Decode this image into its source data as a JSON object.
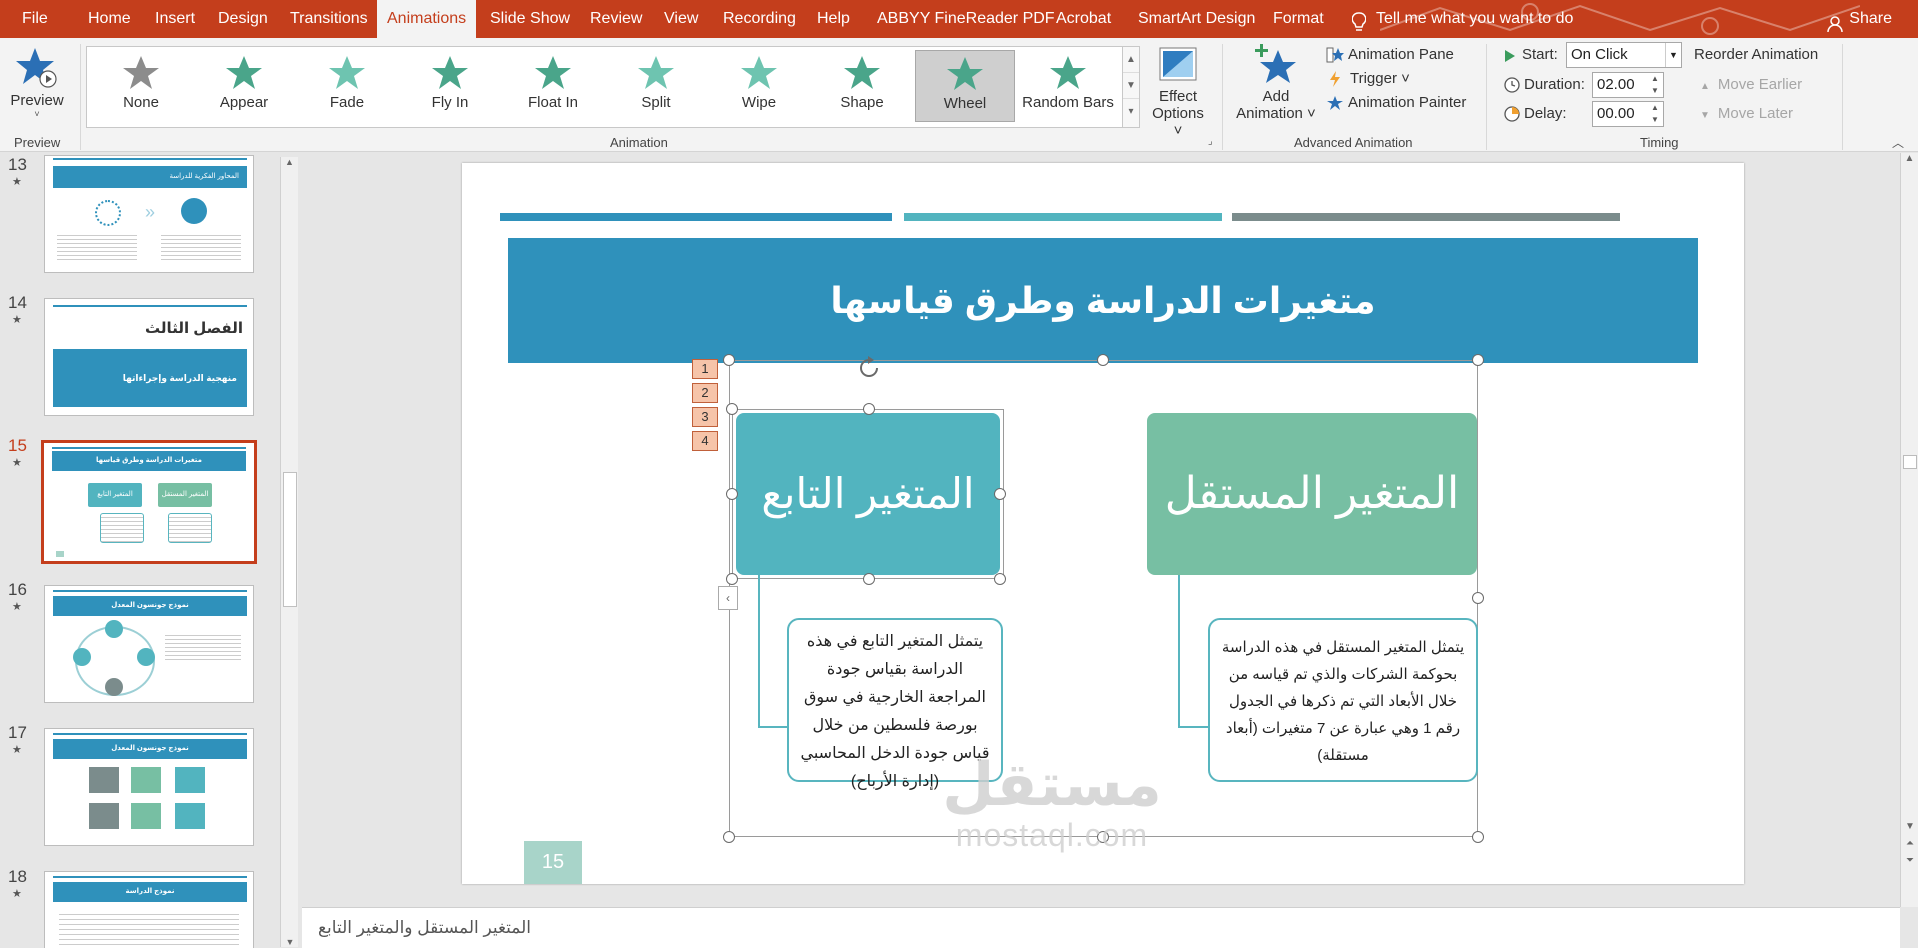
{
  "tabs": [
    {
      "label": "File"
    },
    {
      "label": "Home"
    },
    {
      "label": "Insert"
    },
    {
      "label": "Design"
    },
    {
      "label": "Transitions"
    },
    {
      "label": "Animations",
      "active": true
    },
    {
      "label": "Slide Show"
    },
    {
      "label": "Review"
    },
    {
      "label": "View"
    },
    {
      "label": "Recording"
    },
    {
      "label": "Help"
    },
    {
      "label": "ABBYY FineReader PDF"
    },
    {
      "label": "Acrobat"
    },
    {
      "label": "SmartArt Design"
    },
    {
      "label": "Format"
    }
  ],
  "tell_me": "Tell me what you want to do",
  "share": "Share",
  "ribbon": {
    "preview_label": "Preview",
    "preview_group": "Preview",
    "animations": [
      {
        "label": "None",
        "color": "#8c8c8c"
      },
      {
        "label": "Appear",
        "color": "#4aa58a"
      },
      {
        "label": "Fade",
        "color": "#6ec4b0"
      },
      {
        "label": "Fly In",
        "color": "#4aa58a"
      },
      {
        "label": "Float In",
        "color": "#4aa58a"
      },
      {
        "label": "Split",
        "color": "#6ec4b0"
      },
      {
        "label": "Wipe",
        "color": "#6ec4b0"
      },
      {
        "label": "Shape",
        "color": "#4aa58a"
      },
      {
        "label": "Wheel",
        "color": "#4aa58a",
        "selected": true
      },
      {
        "label": "Random Bars",
        "color": "#4aa58a"
      }
    ],
    "effect_options_1": "Effect",
    "effect_options_2": "Options ˅",
    "animation_group": "Animation",
    "add_animation_1": "Add",
    "add_animation_2": "Animation ˅",
    "animation_pane": "Animation Pane",
    "trigger": "Trigger ˅",
    "animation_painter": "Animation Painter",
    "advanced_group": "Advanced Animation",
    "start_label": "Start:",
    "start_value": "On Click",
    "duration_label": "Duration:",
    "duration_value": "02.00",
    "delay_label": "Delay:",
    "delay_value": "00.00",
    "timing_group": "Timing",
    "reorder": "Reorder Animation",
    "move_earlier": "Move Earlier",
    "move_later": "Move Later"
  },
  "thumbnails": [
    {
      "num": "13",
      "title": "المحاور الفكرية للدراسة"
    },
    {
      "num": "14",
      "title": "الفصل الثالث",
      "subtitle": "منهجية الدراسة وإجراءاتها"
    },
    {
      "num": "15",
      "title": "متغيرات الدراسة وطرق قياسها",
      "left": "المتغير التابع",
      "right": "المتغير المستقل",
      "active": true
    },
    {
      "num": "16",
      "title": "نموذج جونسون المعدل"
    },
    {
      "num": "17",
      "title": "نموذج جونسون المعدل"
    },
    {
      "num": "18",
      "title": "نموذج الدراسة"
    }
  ],
  "slide": {
    "title": "متغيرات الدراسة وطرق قياسها",
    "dependent_header": "المتغير التابع",
    "independent_header": "المتغير المستقل",
    "dependent_desc": "يتمثل المتغير التابع في هذه الدراسة بقياس جودة المراجعة الخارجية في سوق بورصة فلسطين من خلال قياس جودة الدخل المحاسبي (إدارة الأرباح)",
    "independent_desc": "يتمثل المتغير المستقل في هذه الدراسة بحوكمة الشركات والذي تم قياسه من خلال الأبعاد التي تم ذكرها في الجدول رقم 1 وهي عبارة عن 7 متغيرات (أبعاد مستقلة)",
    "anim_tags": [
      "1",
      "2",
      "3",
      "4"
    ],
    "page_number": "15",
    "watermark_ar": "مستقل",
    "watermark_en": "mostaql.com",
    "colors": {
      "band": "#2f91bb",
      "teal": "#52b4bf",
      "green": "#77bfa3",
      "gray": "#7b8c8c"
    }
  },
  "notes": "المتغير المستقل والمتغير التابع"
}
